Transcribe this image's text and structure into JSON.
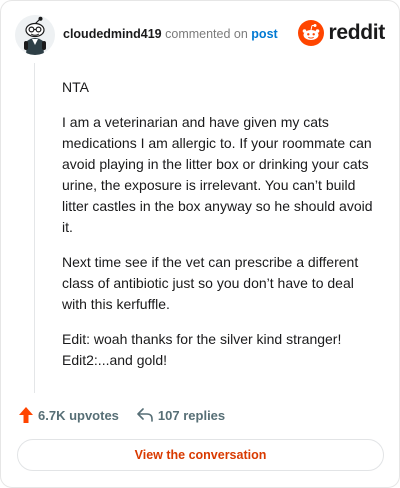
{
  "header": {
    "username": "cloudedmind419",
    "action_text": "commented on",
    "post_link": "post",
    "brand": "reddit"
  },
  "comment": {
    "paragraphs": [
      "NTA",
      "I am a veterinarian and have given my cats medications I am allergic to. If your roommate can avoid playing in the litter box or drinking your cats urine, the exposure is irrelevant. You can’t build litter castles in the box anyway so he should avoid it.",
      "Next time see if the vet can prescribe a different class of antibiotic just so you don’t have to deal with this kerfuffle."
    ],
    "edit1": "Edit: woah thanks for the silver kind stranger!",
    "edit2": "Edit2:...and gold!"
  },
  "footer": {
    "upvotes": "6.7K upvotes",
    "replies": "107 replies",
    "cta": "View the conversation"
  },
  "colors": {
    "accent": "#ff4500",
    "cta_text": "#d93a00",
    "link": "#0079d3",
    "muted": "#576f76"
  },
  "icons": {
    "avatar": "snoo-avatar",
    "brand": "reddit-snoo-icon",
    "upvote": "upvote-arrow-icon",
    "reply": "reply-arrow-icon"
  }
}
